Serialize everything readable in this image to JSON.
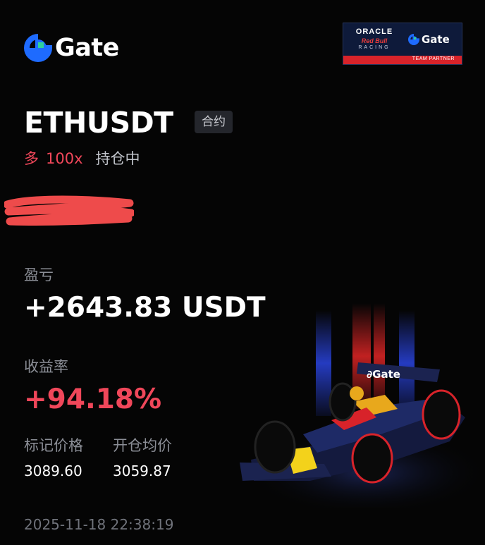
{
  "brand": {
    "name": "Gate",
    "icon": "gate-logo-icon",
    "color": "#1e6bff",
    "accent": "#2ed19c"
  },
  "partner_badge": {
    "oracle": "ORACLE",
    "redbull": "Red Bull",
    "racing": "RACING",
    "gate": "Gate",
    "strip": "TEAM PARTNER"
  },
  "position": {
    "symbol": "ETHUSDT",
    "type_tag": "合约",
    "side": "多",
    "leverage": "100x",
    "status": "持仓中"
  },
  "pnl": {
    "label": "盈亏",
    "value": "+2643.83 USDT"
  },
  "roi": {
    "label": "收益率",
    "value": "+94.18%"
  },
  "mark_price": {
    "label": "标记价格",
    "value": "3089.60"
  },
  "entry_price": {
    "label": "开仓均价",
    "value": "3059.87"
  },
  "timestamp": "2025-11-18 22:38:19",
  "colors": {
    "profit": "#f0475a",
    "background": "#050505",
    "muted": "#8b8e96"
  }
}
